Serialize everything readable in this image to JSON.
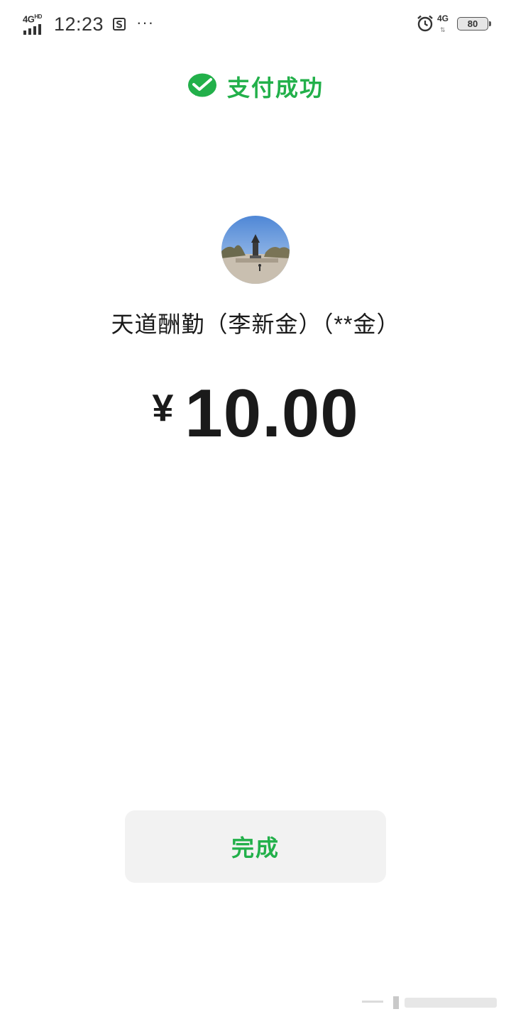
{
  "status_bar": {
    "network_label": "4G",
    "network_sup": "HD",
    "time": "12:23",
    "more": "···",
    "right_network_label": "4G",
    "battery_level": "80"
  },
  "header": {
    "title": "支付成功",
    "icon": "wechat-pay-icon"
  },
  "payee": {
    "name": "天道酬勤（李新金）（**金）",
    "avatar": "statue-photo-avatar"
  },
  "amount": {
    "currency_symbol": "¥",
    "value": "10.00"
  },
  "actions": {
    "done_label": "完成"
  },
  "colors": {
    "accent_green": "#22b04a",
    "button_bg": "#f2f2f2",
    "text": "#1a1a1a"
  }
}
